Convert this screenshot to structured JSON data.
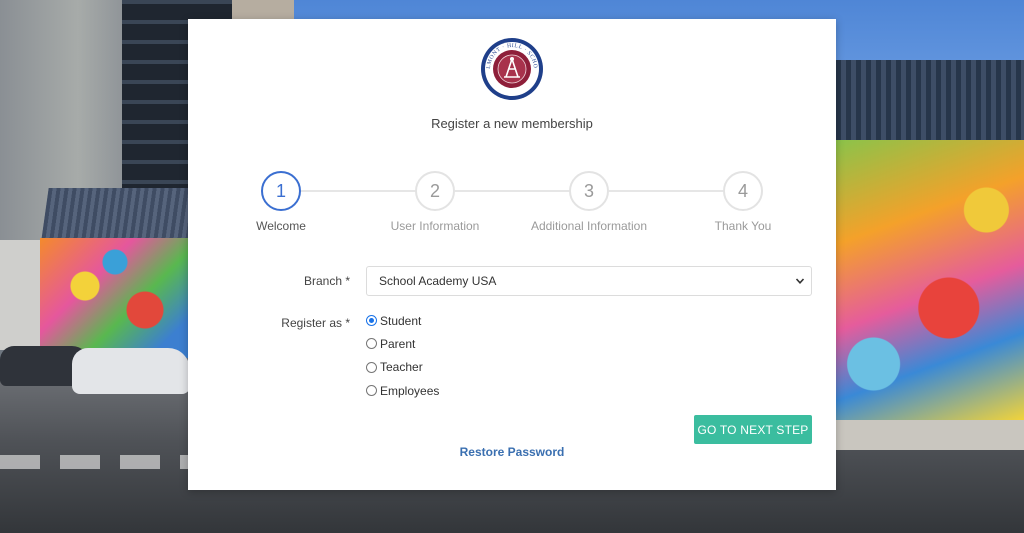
{
  "brand": {
    "logo_text_top": "BELMONT · HILL · SCHOOL",
    "accent_color": "#3b6fd1",
    "button_color": "#3bbd9f",
    "link_color": "#3a6fb0"
  },
  "page": {
    "title": "Register a new membership"
  },
  "stepper": {
    "steps": [
      {
        "number": "1",
        "label": "Welcome",
        "active": true
      },
      {
        "number": "2",
        "label": "User Information",
        "active": false
      },
      {
        "number": "3",
        "label": "Additional Information",
        "active": false
      },
      {
        "number": "4",
        "label": "Thank You",
        "active": false
      }
    ]
  },
  "form": {
    "branch": {
      "label": "Branch *",
      "value": "School Academy USA"
    },
    "register_as": {
      "label": "Register as *",
      "options": [
        {
          "label": "Student",
          "checked": true
        },
        {
          "label": "Parent",
          "checked": false
        },
        {
          "label": "Teacher",
          "checked": false
        },
        {
          "label": "Employees",
          "checked": false
        }
      ]
    },
    "next_button": "GO TO NEXT STEP",
    "restore_link": "Restore Password"
  }
}
